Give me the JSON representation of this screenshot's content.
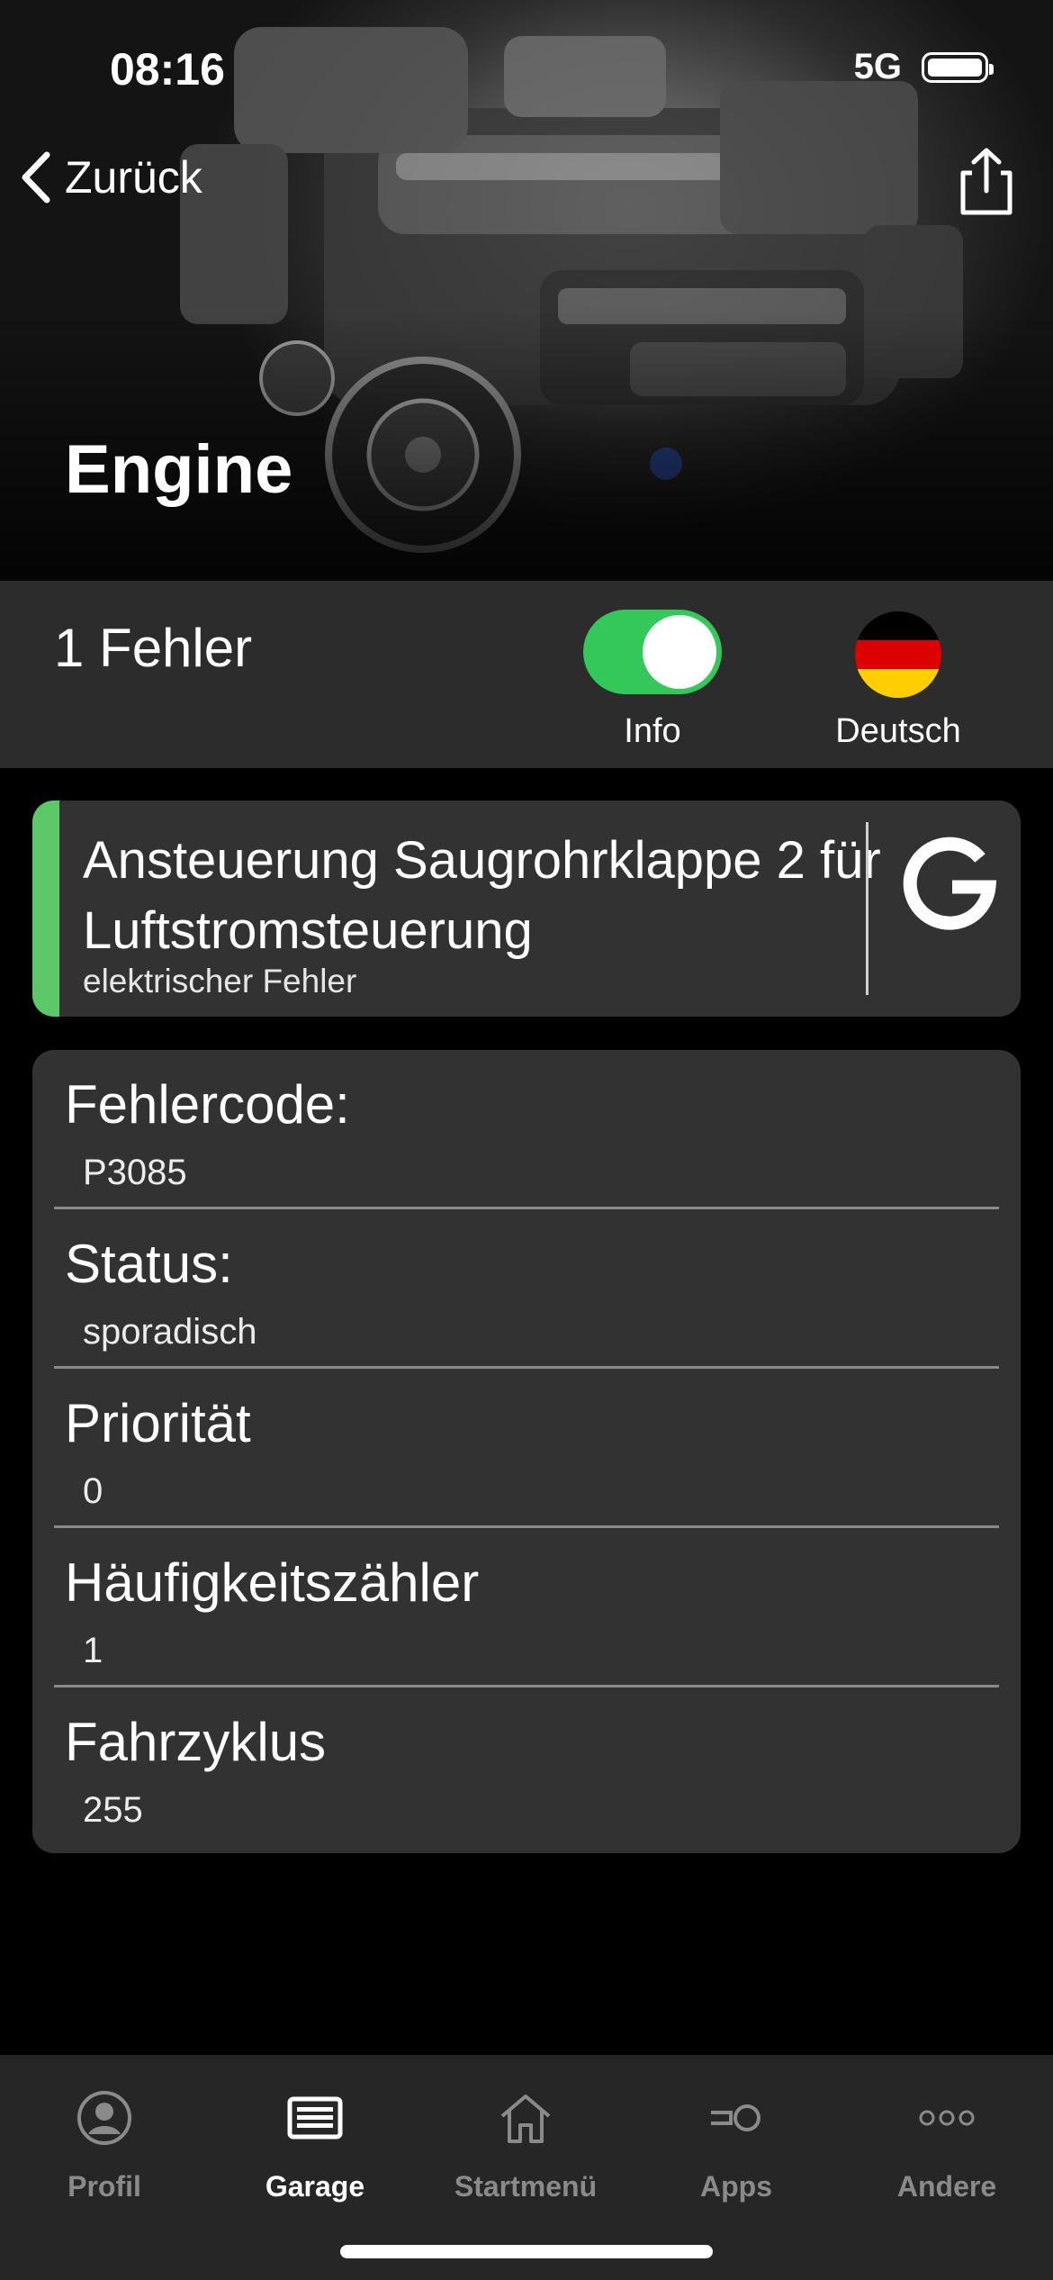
{
  "status_bar": {
    "time": "08:16",
    "network": "5G"
  },
  "nav": {
    "back_label": "Zurück",
    "back_icon": "chevron-left-icon",
    "share_icon": "share-icon"
  },
  "hero": {
    "title": "Engine",
    "image": "engine-photo"
  },
  "summary": {
    "error_count": "1 Fehler",
    "info_toggle": {
      "label": "Info",
      "on": true,
      "color": "#34c759"
    },
    "language": {
      "label": "Deutsch",
      "flag": "german-flag-icon"
    }
  },
  "fault": {
    "title": "Ansteuerung Saugrohrklappe 2 für Luftstromsteuerung",
    "subtitle": "elektrischer Fehler",
    "accent_color": "#5cc86a",
    "translate_icon": "google-g-icon"
  },
  "details": [
    {
      "label": "Fehlercode:",
      "value": "P3085"
    },
    {
      "label": "Status:",
      "value": "sporadisch"
    },
    {
      "label": "Priorität",
      "value": "0"
    },
    {
      "label": "Häufigkeitszähler",
      "value": "1"
    },
    {
      "label": "Fahrzyklus",
      "value": "255"
    }
  ],
  "tabbar": {
    "active": "Garage",
    "items": [
      {
        "label": "Profil",
        "icon": "person-icon"
      },
      {
        "label": "Garage",
        "icon": "garage-icon"
      },
      {
        "label": "Startmenü",
        "icon": "home-icon"
      },
      {
        "label": "Apps",
        "icon": "apps-icon"
      },
      {
        "label": "Andere",
        "icon": "more-icon"
      }
    ]
  }
}
